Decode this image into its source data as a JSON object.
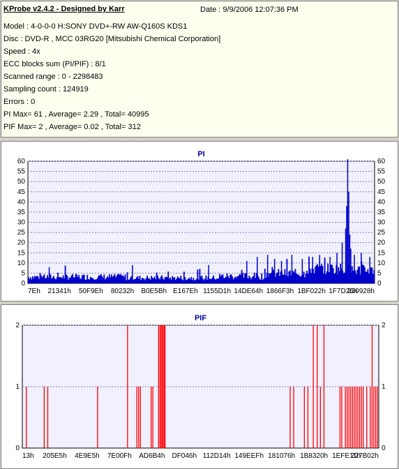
{
  "info": {
    "title": "KProbe v2.4.2 - Designed by Karr",
    "date": "Date : 9/9/2006 12:07:36 PM",
    "lines": [
      "Model : 4-0-0-0 H:SONY    DVD+-RW AW-Q160S KDS1",
      "Disc : DVD-R , MCC 03RG20  [Mitsubishi Chemical Corporation]",
      "Speed : 4x",
      "ECC blocks sum (PI/PIF) : 8/1",
      "Scanned range : 0 - 2298483",
      "Sampling count : 124919",
      "Errors : 0",
      "PI Max= 61 , Average= 2.29 , Total= 40995",
      "PIF Max= 2 , Average= 0.02 , Total= 312"
    ]
  },
  "colors": {
    "pi_bar": "#0000cc",
    "pif_bar": "#ff0000",
    "plot_bg": "#f0f0ff",
    "grid": "#8080c0"
  },
  "chart_data": [
    {
      "type": "bar",
      "title": "PI",
      "ylim": [
        0,
        60
      ],
      "yticks": [
        0,
        5,
        10,
        15,
        20,
        25,
        30,
        35,
        40,
        45,
        50,
        55,
        60
      ],
      "xticks": [
        "7Eh",
        "21341h",
        "50F9Eh",
        "80232h",
        "B0E5Bh",
        "E167Eh",
        "1155D1h",
        "14DE64h",
        "1866F3h",
        "1BF022h",
        "1F7D26h",
        "230928h"
      ],
      "grid": true,
      "segments": [
        {
          "from": 0.0,
          "to": 0.28,
          "base": 2.6,
          "spread": 3.0
        },
        {
          "from": 0.28,
          "to": 0.55,
          "base": 2.2,
          "spread": 2.6
        },
        {
          "from": 0.55,
          "to": 0.68,
          "base": 2.8,
          "spread": 3.6
        },
        {
          "from": 0.68,
          "to": 0.8,
          "base": 4.0,
          "spread": 4.6
        },
        {
          "from": 0.8,
          "to": 0.92,
          "base": 6.0,
          "spread": 6.0
        },
        {
          "from": 0.92,
          "to": 1.0,
          "base": 5.5,
          "spread": 5.5
        }
      ],
      "peaks": [
        {
          "x": 0.06,
          "value": 8
        },
        {
          "x": 0.3,
          "value": 9
        },
        {
          "x": 0.52,
          "value": 9
        },
        {
          "x": 0.63,
          "value": 11
        },
        {
          "x": 0.66,
          "value": 13
        },
        {
          "x": 0.69,
          "value": 14
        },
        {
          "x": 0.71,
          "value": 12
        },
        {
          "x": 0.73,
          "value": 11
        },
        {
          "x": 0.76,
          "value": 14
        },
        {
          "x": 0.79,
          "value": 12
        },
        {
          "x": 0.82,
          "value": 13
        },
        {
          "x": 0.84,
          "value": 14
        },
        {
          "x": 0.87,
          "value": 13
        },
        {
          "x": 0.89,
          "value": 15
        },
        {
          "x": 0.905,
          "value": 20
        },
        {
          "x": 0.915,
          "value": 27
        },
        {
          "x": 0.918,
          "value": 38
        },
        {
          "x": 0.921,
          "value": 61
        },
        {
          "x": 0.924,
          "value": 45
        },
        {
          "x": 0.927,
          "value": 24
        },
        {
          "x": 0.93,
          "value": 17
        },
        {
          "x": 0.94,
          "value": 14
        },
        {
          "x": 0.96,
          "value": 15
        },
        {
          "x": 0.985,
          "value": 13
        }
      ]
    },
    {
      "type": "bar",
      "title": "PIF",
      "ylim": [
        0,
        2
      ],
      "yticks": [
        0,
        1,
        2
      ],
      "xticks": [
        "13h",
        "205E5h",
        "4E9E5h",
        "7E00Fh",
        "AD6B4h",
        "DF046h",
        "112D14h",
        "149EEFh",
        "181076h",
        "1B8320h",
        "1EFE11h",
        "227B02h"
      ],
      "grid": true,
      "values_at_2": [
        0.385,
        0.388,
        0.391,
        0.394,
        0.397,
        0.399,
        0.381,
        0.294,
        0.845,
        0.815,
        0.826,
        0.98
      ],
      "values_at_1": [
        0.01,
        0.06,
        0.07,
        0.21,
        0.32,
        0.325,
        0.33,
        0.36,
        0.365,
        0.75,
        0.76,
        0.79,
        0.8,
        0.835,
        0.89,
        0.895,
        0.905,
        0.91,
        0.915,
        0.92,
        0.925,
        0.93,
        0.935,
        0.94,
        0.945,
        0.95,
        0.955,
        0.965,
        0.985,
        0.99,
        0.995,
        0.975
      ]
    }
  ]
}
